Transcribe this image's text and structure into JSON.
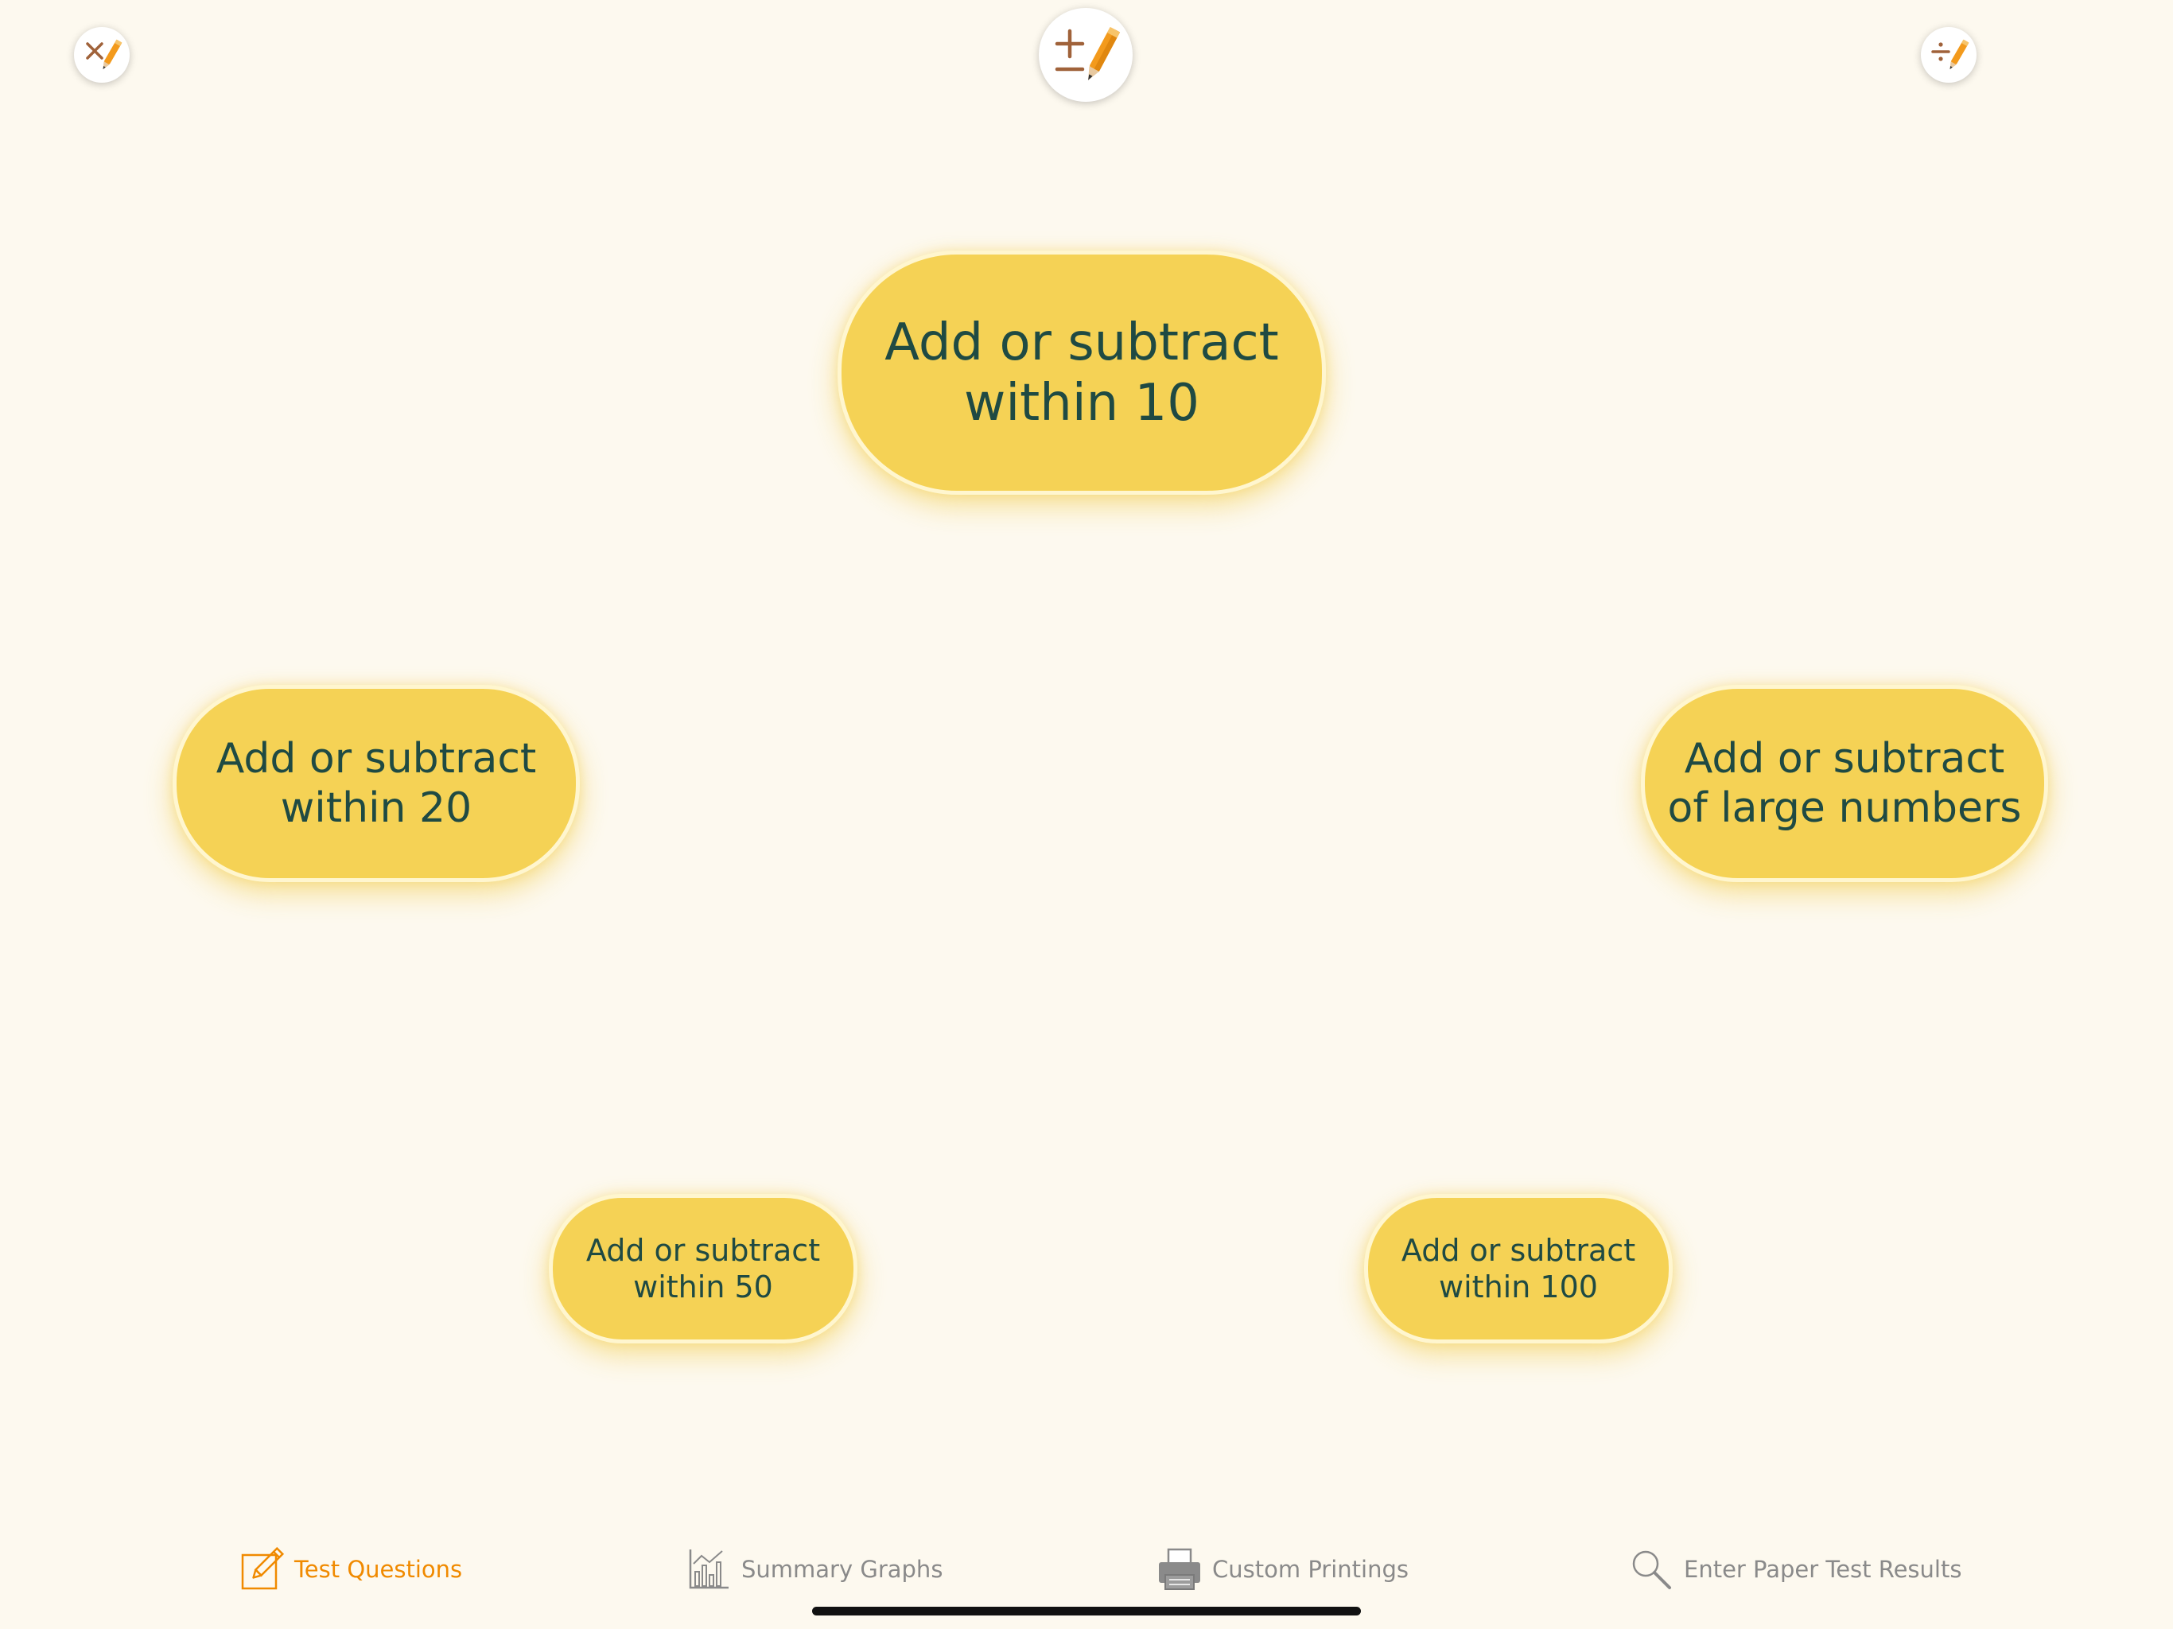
{
  "top_bar": {
    "left_icon": "multiply-pencil-icon",
    "center_icon": "plus-minus-pencil-icon",
    "right_icon": "divide-pencil-icon"
  },
  "categories": [
    {
      "label": "Add or subtract\nwithin 10"
    },
    {
      "label": "Add or subtract\nwithin 20"
    },
    {
      "label": "Add or subtract\nof large numbers"
    },
    {
      "label": "Add or subtract\nwithin 50"
    },
    {
      "label": "Add or subtract\nwithin 100"
    }
  ],
  "tabs": [
    {
      "label": "Test Questions",
      "icon": "pencil-square-icon",
      "active": true
    },
    {
      "label": "Summary Graphs",
      "icon": "bar-graph-icon",
      "active": false
    },
    {
      "label": "Custom Printings",
      "icon": "printer-icon",
      "active": false
    },
    {
      "label": "Enter Paper Test Results",
      "icon": "magnifier-icon",
      "active": false
    }
  ],
  "colors": {
    "background": "#fdf9ef",
    "bubble_fill": "#f5d255",
    "bubble_text": "#1f4a43",
    "tab_active": "#f08a00",
    "tab_inactive": "#8a8a8a",
    "symbol_brown": "#a0623a",
    "pencil_orange": "#f39a1c"
  }
}
